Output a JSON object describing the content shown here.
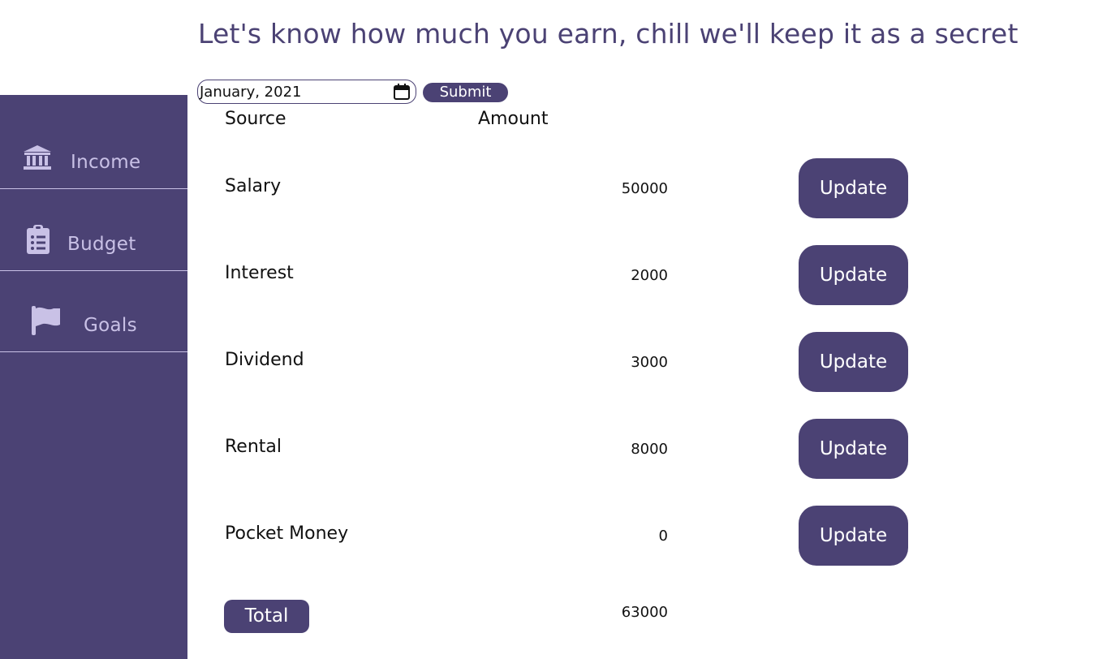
{
  "header": {
    "title": "Let's know how much you earn, chill we'll keep it as a secret"
  },
  "sidebar": {
    "items": [
      {
        "label": "Income",
        "icon": "bank-icon"
      },
      {
        "label": "Budget",
        "icon": "clipboard-list-icon"
      },
      {
        "label": "Goals",
        "icon": "flag-icon"
      }
    ]
  },
  "form": {
    "date_value": "January, 2021",
    "submit_label": "Submit"
  },
  "table": {
    "headers": {
      "source": "Source",
      "amount": "Amount"
    },
    "rows": [
      {
        "source": "Salary",
        "amount": "50000",
        "action": "Update"
      },
      {
        "source": "Interest",
        "amount": "2000",
        "action": "Update"
      },
      {
        "source": "Dividend",
        "amount": "3000",
        "action": "Update"
      },
      {
        "source": "Rental",
        "amount": "8000",
        "action": "Update"
      },
      {
        "source": "Pocket Money",
        "amount": "0",
        "action": "Update"
      }
    ],
    "total_label": "Total",
    "total_value": "63000"
  },
  "colors": {
    "accent": "#4b4274",
    "sidebar_text": "#c9c1e6"
  }
}
